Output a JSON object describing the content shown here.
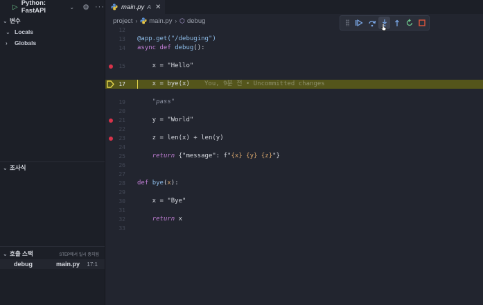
{
  "debug_toolbar": {
    "config_name": "Python: FastAPI"
  },
  "variables": {
    "title": "변수",
    "scopes": [
      {
        "label": "Locals",
        "expanded": true
      },
      {
        "label": "Globals",
        "expanded": false
      }
    ]
  },
  "watch": {
    "title": "조사식"
  },
  "call_stack": {
    "title": "호출 스택",
    "status": "STEP에서 일시 중지됨",
    "frames": [
      {
        "function": "debug",
        "file": "main.py",
        "position": "17:1"
      }
    ]
  },
  "tab": {
    "label": "main.py",
    "modified_marker": "A"
  },
  "breadcrumb": {
    "folder": "project",
    "file": "main.py",
    "symbol": "debug"
  },
  "editor": {
    "current_line": "17",
    "blame": "You, 9분 전 • Uncommitted changes",
    "lines": [
      {
        "n": "12",
        "code": ""
      },
      {
        "n": "13",
        "code": "@app.get(\"/debuging\")"
      },
      {
        "n": "14",
        "code": "async def debug():"
      },
      {
        "n": "",
        "code": ""
      },
      {
        "n": "15",
        "code": "    x = \"Hello\""
      },
      {
        "n": "",
        "code": ""
      },
      {
        "n": "17",
        "code": "    x = bye(x)"
      },
      {
        "n": "",
        "code": ""
      },
      {
        "n": "19",
        "code": "    \"pass\""
      },
      {
        "n": "20",
        "code": ""
      },
      {
        "n": "21",
        "code": "    y = \"World\""
      },
      {
        "n": "22",
        "code": ""
      },
      {
        "n": "23",
        "code": "    z = len(x) + len(y)"
      },
      {
        "n": "24",
        "code": ""
      },
      {
        "n": "25",
        "code": "    return {\"message\": f\"{x} {y} {z}\"}"
      },
      {
        "n": "26",
        "code": ""
      },
      {
        "n": "27",
        "code": ""
      },
      {
        "n": "28",
        "code": "def bye(x):"
      },
      {
        "n": "29",
        "code": ""
      },
      {
        "n": "30",
        "code": "    x = \"Bye\""
      },
      {
        "n": "31",
        "code": ""
      },
      {
        "n": "32",
        "code": "    return x"
      },
      {
        "n": "33",
        "code": ""
      }
    ]
  },
  "colors": {
    "accent_play": "#6ec98d",
    "breakpoint": "#d8334a",
    "current_line_bg": "#54551b",
    "stop_button": "#e0563c"
  }
}
